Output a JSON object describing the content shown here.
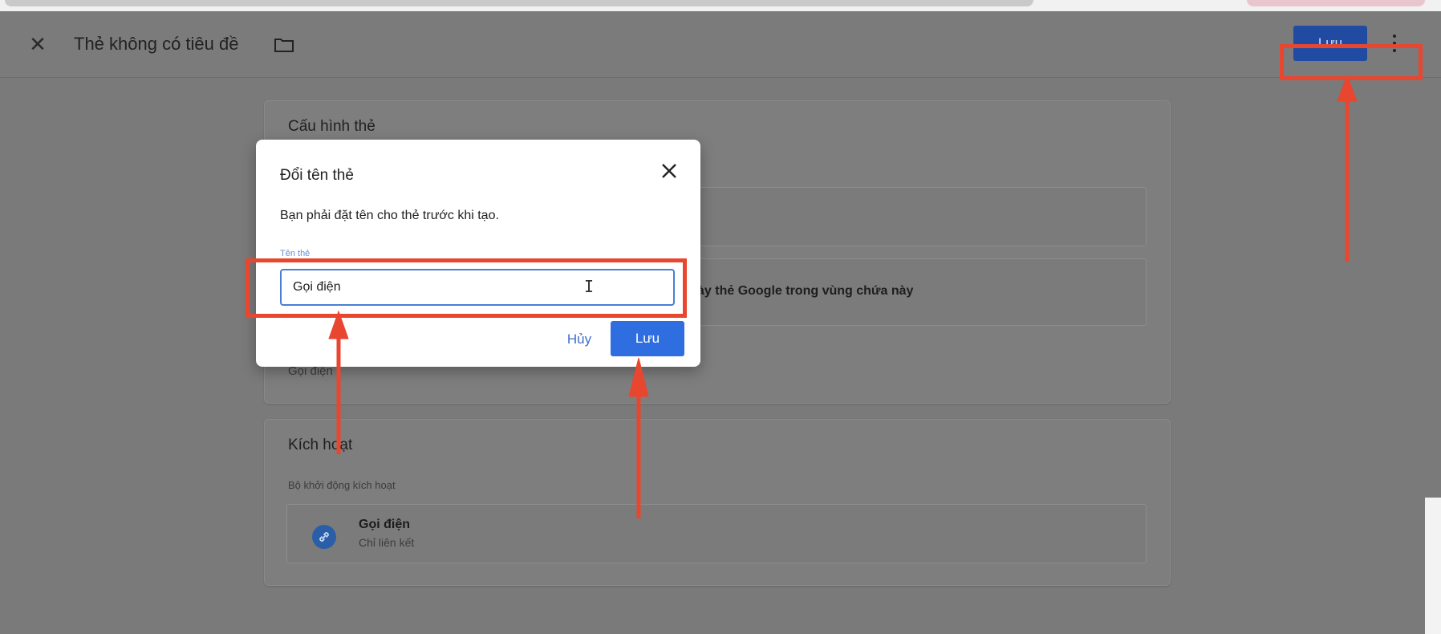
{
  "header": {
    "title": "Thẻ không có tiêu đề",
    "save_label": "Lưu"
  },
  "tag_config": {
    "title": "Cấu hình thẻ",
    "visible_text": "ày thẻ Google trong vùng chứa này",
    "partial_value": "Gọi điện"
  },
  "triggering": {
    "title": "Kích hoạt",
    "subtitle": "Bộ khởi động kích hoạt",
    "trigger": {
      "name": "Gọi điện",
      "type": "Chỉ liên kết"
    }
  },
  "rename_dialog": {
    "title": "Đổi tên thẻ",
    "message": "Bạn phải đặt tên cho thẻ trước khi tạo.",
    "field_label": "Tên thẻ",
    "field_value": "Gọi điện",
    "cancel_label": "Hủy",
    "save_label": "Lưu"
  },
  "colors": {
    "primary_button": "#2f6ee0",
    "annotation": "#e8462f"
  },
  "icons": [
    "close-icon",
    "folder-icon",
    "more-vert-icon",
    "link-icon"
  ]
}
